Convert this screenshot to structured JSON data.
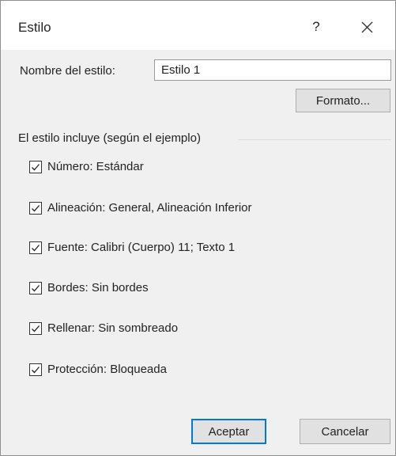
{
  "dialog": {
    "title": "Estilo",
    "help_label": "?"
  },
  "style_name": {
    "label": "Nombre del estilo:",
    "value": "Estilo 1"
  },
  "format_button": "Formato...",
  "includes": {
    "label": "El estilo incluye (según el ejemplo)",
    "items": [
      {
        "label": "Número: Estándar",
        "checked": true
      },
      {
        "label": "Alineación: General, Alineación Inferior",
        "checked": true
      },
      {
        "label": "Fuente: Calibri (Cuerpo) 11; Texto 1",
        "checked": true
      },
      {
        "label": "Bordes: Sin bordes",
        "checked": true
      },
      {
        "label": "Rellenar: Sin sombreado",
        "checked": true
      },
      {
        "label": "Protección: Bloqueada",
        "checked": true
      }
    ]
  },
  "buttons": {
    "ok": "Aceptar",
    "cancel": "Cancelar"
  },
  "colors": {
    "default_button_border": "#0078d7",
    "background": "#f0f0f0"
  }
}
